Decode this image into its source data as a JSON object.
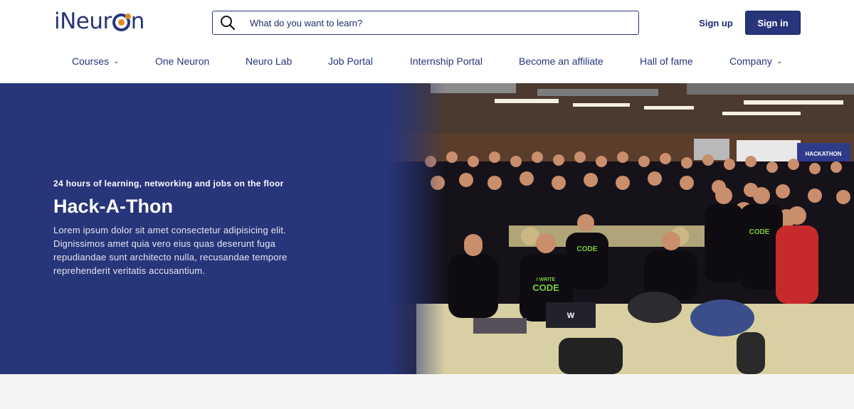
{
  "brand": {
    "name_part1": "iNeur",
    "name_part2": "n"
  },
  "search": {
    "placeholder": "What do you want to learn?"
  },
  "auth": {
    "signup": "Sign up",
    "signin": "Sign in"
  },
  "nav": [
    {
      "label": "Courses",
      "has_dropdown": true
    },
    {
      "label": "One Neuron"
    },
    {
      "label": "Neuro Lab"
    },
    {
      "label": "Job Portal"
    },
    {
      "label": "Internship Portal"
    },
    {
      "label": "Become an affiliate"
    },
    {
      "label": "Hall of fame"
    },
    {
      "label": "Company",
      "has_dropdown": true
    }
  ],
  "hero": {
    "eyebrow": "24 hours of learning, networking and jobs on the floor",
    "title": "Hack-A-Thon",
    "body": "Lorem ipsum dolor sit amet consectetur adipisicing elit. Dignissimos amet quia vero eius quas deserunt fuga repudiandae sunt architecto nulla, recusandae tempore reprehenderit veritatis accusantium.",
    "photo_text": {
      "shirt_line1": "I WRITE",
      "shirt_line2": "CODE",
      "banner": "HACKATHON",
      "laptop_logo": "W"
    }
  },
  "colors": {
    "brand": "#27357a",
    "accent": "#e08a2a",
    "shirt_text": "#7ac943"
  }
}
